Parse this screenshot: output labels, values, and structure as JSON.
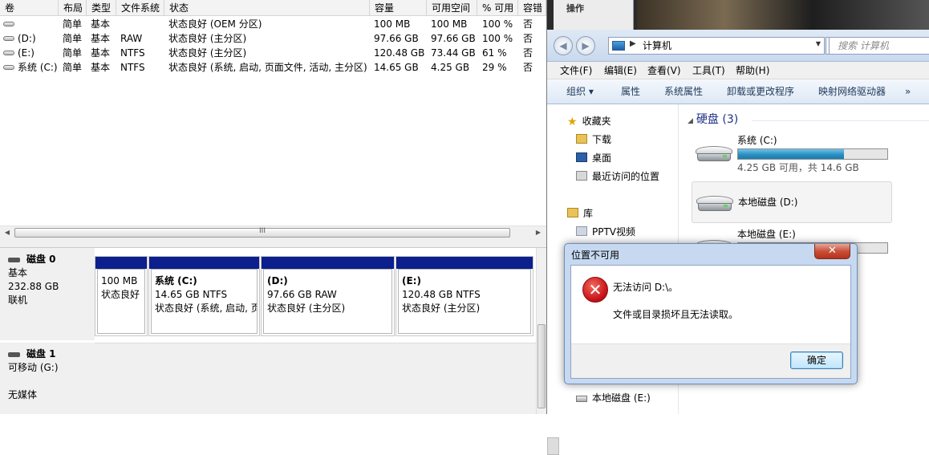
{
  "volume_list": {
    "columns": [
      "卷",
      "布局",
      "类型",
      "文件系统",
      "状态",
      "容量",
      "可用空间",
      "% 可用",
      "容错"
    ],
    "rows": [
      {
        "volume": "",
        "layout": "简单",
        "type": "基本",
        "fs": "",
        "status": "状态良好 (OEM 分区)",
        "capacity": "100 MB",
        "free": "100 MB",
        "pct": "100 %",
        "fault": "否"
      },
      {
        "volume": "(D:)",
        "layout": "简单",
        "type": "基本",
        "fs": "RAW",
        "status": "状态良好 (主分区)",
        "capacity": "97.66 GB",
        "free": "97.66 GB",
        "pct": "100 %",
        "fault": "否"
      },
      {
        "volume": "(E:)",
        "layout": "简单",
        "type": "基本",
        "fs": "NTFS",
        "status": "状态良好 (主分区)",
        "capacity": "120.48 GB",
        "free": "73.44 GB",
        "pct": "61 %",
        "fault": "否"
      },
      {
        "volume": "系统 (C:)",
        "layout": "简单",
        "type": "基本",
        "fs": "NTFS",
        "status": "状态良好 (系统, 启动, 页面文件, 活动, 主分区)",
        "capacity": "14.65 GB",
        "free": "4.25 GB",
        "pct": "29 %",
        "fault": "否"
      }
    ],
    "scroll_grip": "III"
  },
  "disk0": {
    "name": "磁盘 0",
    "type": "基本",
    "size": "232.88 GB",
    "status": "联机",
    "partitions": [
      {
        "title": "",
        "size_fs": "100 MB",
        "status": "状态良好"
      },
      {
        "title": "系统  (C:)",
        "size_fs": "14.65 GB NTFS",
        "status": "状态良好 (系统, 启动, 页"
      },
      {
        "title": "(D:)",
        "size_fs": "97.66 GB RAW",
        "status": "状态良好 (主分区)"
      },
      {
        "title": "(E:)",
        "size_fs": "120.48 GB NTFS",
        "status": "状态良好 (主分区)"
      }
    ]
  },
  "disk1": {
    "name": "磁盘 1",
    "type": "可移动 (G:)",
    "media": "无媒体"
  },
  "explorer": {
    "top_panel_label": "操作",
    "address": "计算机",
    "search_placeholder": "搜索 计算机",
    "menu": [
      "文件(F)",
      "编辑(E)",
      "查看(V)",
      "工具(T)",
      "帮助(H)"
    ],
    "commands": [
      "组织 ▾",
      "属性",
      "系统属性",
      "卸载或更改程序",
      "映射网络驱动器",
      "»"
    ],
    "nav": {
      "favorites": "收藏夹",
      "downloads": "下载",
      "desktop": "桌面",
      "recent": "最近访问的位置",
      "libraries": "库",
      "pptv": "PPTV视频",
      "bottom_drive": "本地磁盘 (E:)"
    },
    "group_header": "硬盘 (3)",
    "drives": [
      {
        "name": "系统 (C:)",
        "free_text": "4.25 GB 可用，共 14.6 GB",
        "used_fraction": 0.71
      },
      {
        "name": "本地磁盘 (D:)"
      },
      {
        "name": "本地磁盘 (E:)",
        "used_fraction": 0.39
      }
    ]
  },
  "dialog": {
    "title": "位置不可用",
    "close": "✕",
    "message1": "无法访问 D:\\。",
    "message2": "文件或目录损坏且无法读取。",
    "ok": "确定"
  },
  "colors": {
    "partition_bar": "#0b1f8d",
    "drive_fill": "#2a8fc1",
    "error_red": "#c8121a"
  }
}
